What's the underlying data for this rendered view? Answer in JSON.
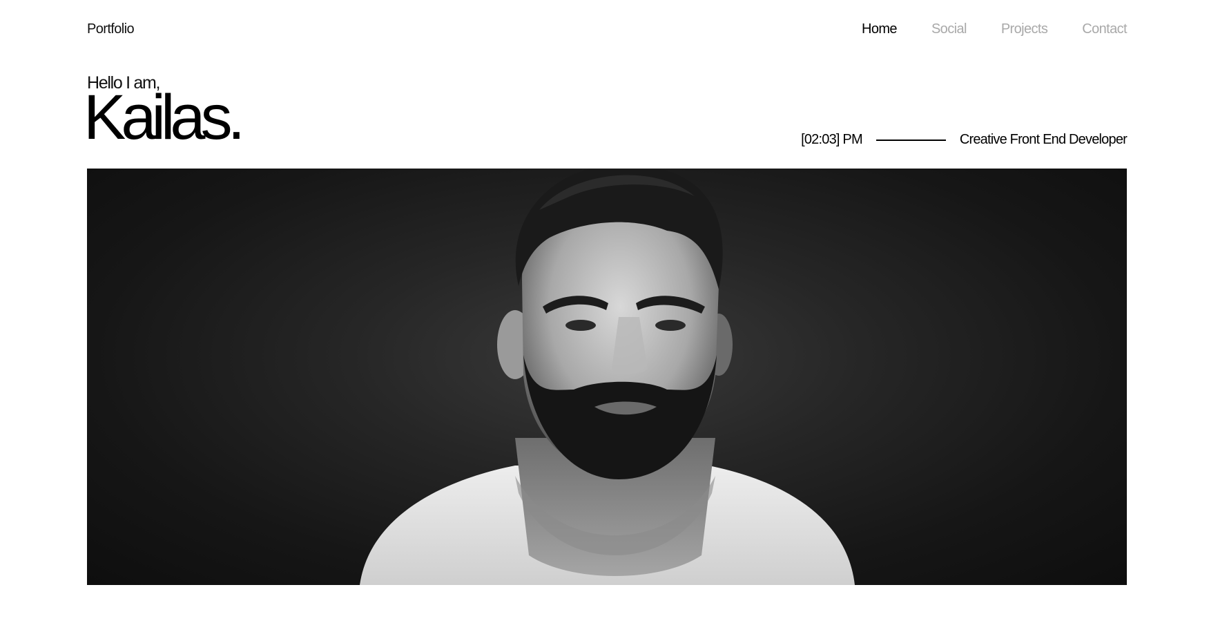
{
  "header": {
    "brand": "Portfolio",
    "nav": [
      {
        "label": "Home",
        "active": true
      },
      {
        "label": "Social",
        "active": false
      },
      {
        "label": "Projects",
        "active": false
      },
      {
        "label": "Contact",
        "active": false
      }
    ]
  },
  "intro": {
    "greeting": "Hello I am,",
    "name": "Kailas.",
    "time": "[02:03] PM",
    "role": "Creative Front End Developer"
  },
  "hero": {
    "subject": "black-and-white portrait photo",
    "style": "grayscale"
  },
  "colors": {
    "text": "#000000",
    "nav_inactive": "#a9a9a9",
    "background": "#ffffff"
  }
}
